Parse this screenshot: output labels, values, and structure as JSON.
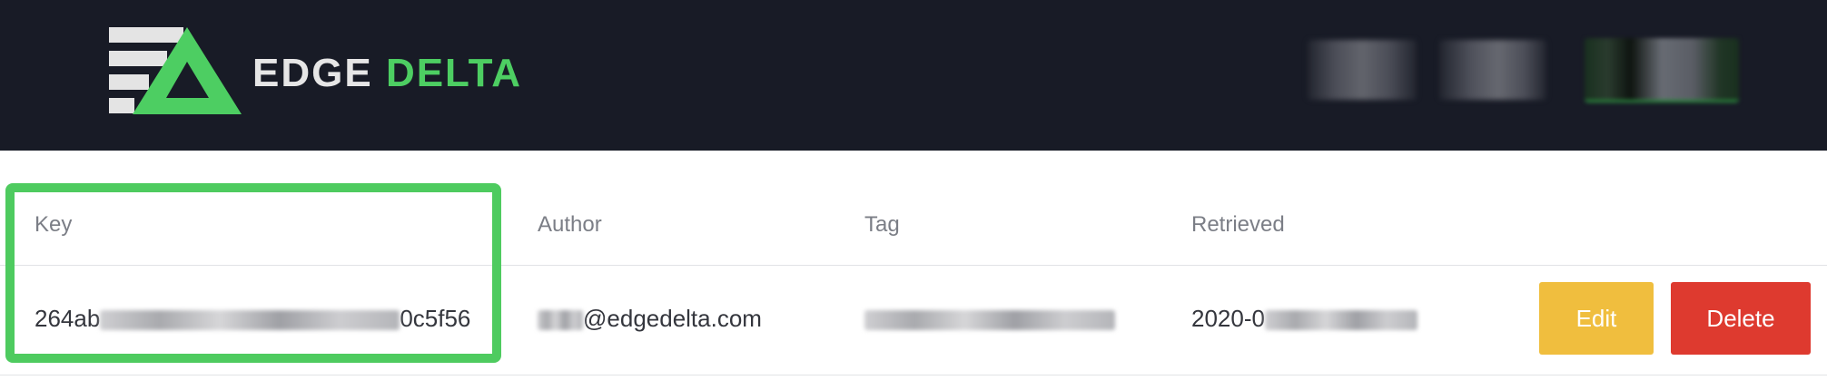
{
  "brand": {
    "name_part1": "EDGE",
    "name_part2": "DELTA",
    "logo_icon": "edge-delta-logo-icon",
    "accent_color": "#4dce62"
  },
  "table": {
    "columns": [
      "Key",
      "Author",
      "Tag",
      "Retrieved"
    ],
    "rows": [
      {
        "key_prefix": "264ab",
        "key_suffix": "0c5f56",
        "author_suffix": "@edgedelta.com",
        "retrieved_prefix": "2020-0"
      }
    ]
  },
  "actions": {
    "edit_label": "Edit",
    "delete_label": "Delete",
    "edit_color": "#f0be3e",
    "delete_color": "#de3a2f"
  },
  "highlight": {
    "color": "#4ecb5f"
  }
}
